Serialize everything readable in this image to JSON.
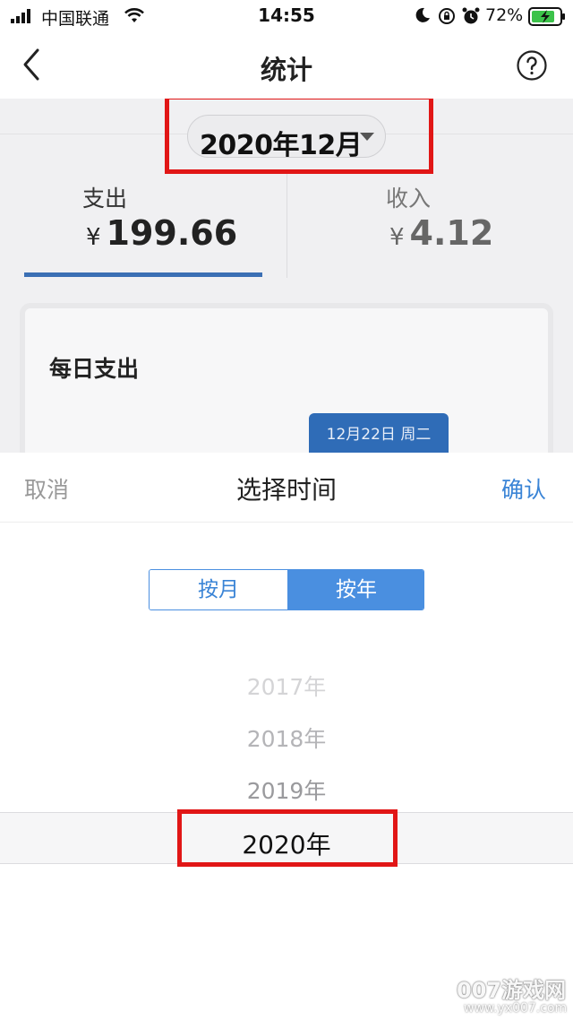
{
  "status_bar": {
    "carrier": "中国联通",
    "time": "14:55",
    "battery_percent": "72%",
    "icons": [
      "signal-icon",
      "wifi-icon",
      "moon-icon",
      "rotation-lock-icon",
      "alarm-icon",
      "battery-charging-icon"
    ]
  },
  "nav": {
    "title": "统计",
    "back_icon": "chevron-left-icon",
    "help_icon": "question-circle-icon"
  },
  "background_page": {
    "month_selector": "2020年12月",
    "tabs": [
      {
        "label": "支出",
        "currency": "¥",
        "amount": "199.66",
        "active": true
      },
      {
        "label": "收入",
        "currency": "¥",
        "amount": "4.12",
        "active": false
      }
    ],
    "card_title": "每日支出",
    "tooltip_text": "12月22日 周二"
  },
  "sheet": {
    "cancel_label": "取消",
    "title": "选择时间",
    "confirm_label": "确认",
    "segments": [
      {
        "label": "按月",
        "selected": false
      },
      {
        "label": "按年",
        "selected": true
      }
    ],
    "years": [
      "2017年",
      "2018年",
      "2019年",
      "2020年"
    ],
    "selected_year": "2020年"
  },
  "watermark": {
    "main": "007游戏网",
    "url": "www.yx007.com"
  },
  "colors": {
    "accent_blue": "#3a84d6",
    "highlight_red": "#e11616",
    "tab_underline": "#3b6fb4"
  }
}
